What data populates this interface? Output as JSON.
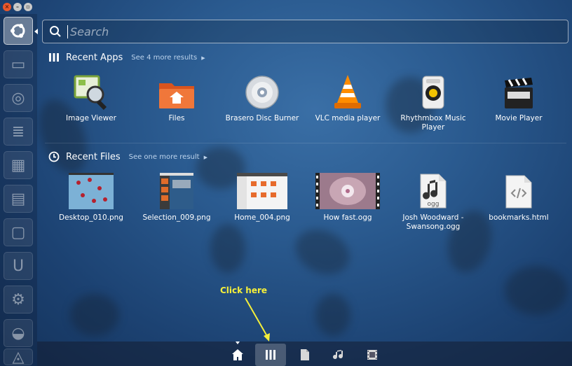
{
  "search": {
    "placeholder": "Search"
  },
  "recent_apps": {
    "title": "Recent Apps",
    "more": "See 4 more results",
    "items": [
      {
        "label": "Image Viewer",
        "icon": "image-viewer-icon"
      },
      {
        "label": "Files",
        "icon": "files-icon"
      },
      {
        "label": "Brasero Disc Burner",
        "icon": "brasero-icon"
      },
      {
        "label": "VLC media player",
        "icon": "vlc-icon"
      },
      {
        "label": "Rhythmbox Music Player",
        "icon": "rhythmbox-icon"
      },
      {
        "label": "Movie Player",
        "icon": "movie-player-icon"
      }
    ]
  },
  "recent_files": {
    "title": "Recent Files",
    "more": "See one more result",
    "items": [
      {
        "label": "Desktop_010.png"
      },
      {
        "label": "Selection_009.png"
      },
      {
        "label": "Home_004.png"
      },
      {
        "label": "How fast.ogg"
      },
      {
        "label": "Josh Woodward - Swansong.ogg"
      },
      {
        "label": "bookmarks.html"
      }
    ]
  },
  "file_thumb_text": {
    "ogg": "ogg"
  },
  "callout": {
    "text": "Click here",
    "color": "#f5ef3a"
  },
  "lenses": [
    "home-lens",
    "applications-lens",
    "files-lens",
    "music-lens",
    "video-lens"
  ],
  "colors": {
    "accent": "#e9572b",
    "background": "#2a5a8f"
  }
}
